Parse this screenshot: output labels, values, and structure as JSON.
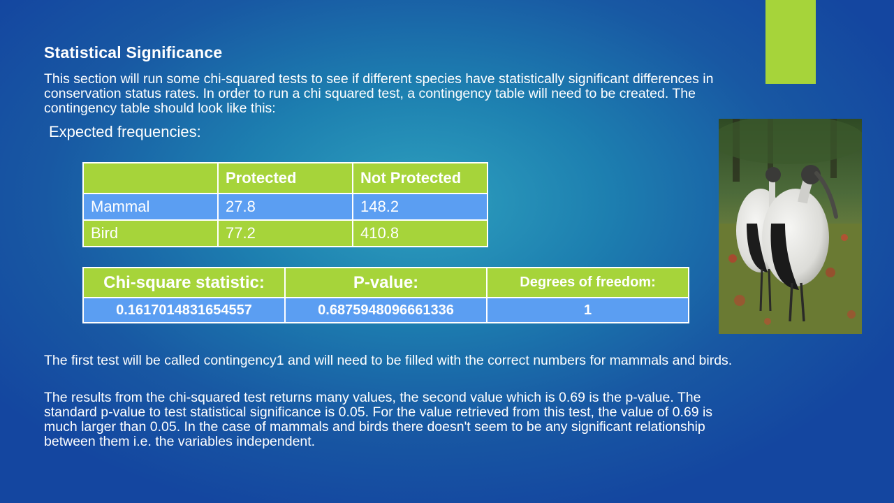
{
  "slide": {
    "title": "Statistical Significance",
    "intro": "This section will run some chi-squared tests to see if different species have statistically significant differences in conservation status rates. In order to run a chi squared test, a contingency table will need to be created. The contingency table should look like this:",
    "subheading": "Expected frequencies:",
    "paragraph1": "The first test will be called contingency1 and will need to be filled with the correct numbers for mammals and birds.",
    "paragraph2": "The results from the chi-squared test returns many values, the second value which is 0.69 is the p-value. The standard p-value to test statistical significance is 0.05. For the value retrieved from this test, the value of 0.69 is much larger than 0.05. In the case of mammals and birds there doesn't seem to be any significant relationship between them i.e. the variables independent."
  },
  "expected_table": {
    "headers": [
      "",
      "Protected",
      "Not Protected"
    ],
    "rows": [
      [
        "Mammal",
        "27.8",
        "148.2"
      ],
      [
        "Bird",
        "77.2",
        "410.8"
      ]
    ]
  },
  "chi_table": {
    "headers": [
      "Chi-square statistic:",
      "P-value:",
      "Degrees of freedom:"
    ],
    "values": [
      "0.1617014831654557",
      "0.6875948096661336",
      "1"
    ]
  },
  "colors": {
    "accent_green": "#a6d43a",
    "table_blue": "#5b9ef2",
    "background": "#1858a3"
  },
  "image": {
    "icon": "storks-photo"
  }
}
